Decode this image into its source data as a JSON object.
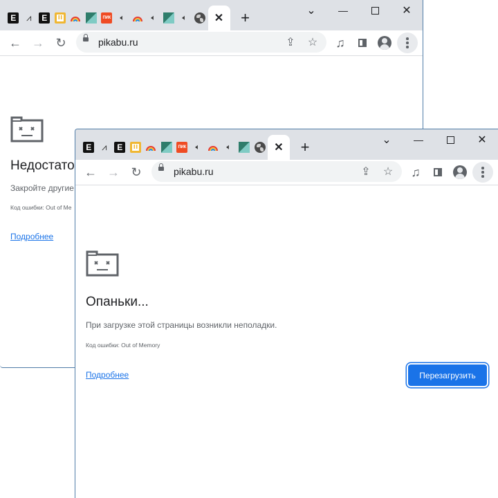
{
  "browser": {
    "url": "pikabu.ru",
    "new_tab_glyph": "+",
    "tab_close_glyph": "✕"
  },
  "favicons": [
    "e-logo-icon",
    "wave-icon",
    "e-logo-icon",
    "pause-logo-icon",
    "rainbow-icon",
    "mosaic-icon",
    "pik-logo-icon",
    "volume-icon",
    "rainbow-icon",
    "volume-icon",
    "mosaic-icon",
    "volume-icon",
    "globe-icon"
  ],
  "favicon_letters": {
    "e": "E",
    "pik": "ПИК"
  },
  "window_controls": {
    "chevron": "⌄",
    "minimize": "—",
    "close": "✕"
  },
  "toolbar_glyphs": {
    "back": "←",
    "forward": "→",
    "reload": "↻",
    "share": "⇪",
    "star": "☆",
    "media": "♫"
  },
  "back_window": {
    "title": "Недостато",
    "description": "Закройте другие в",
    "error_code": "Код ошибки: Out of Me",
    "details_link": "Подробнее"
  },
  "front_window": {
    "title": "Опаньки...",
    "description": "При загрузке этой страницы возникли неполадки.",
    "error_code": "Код ошибки: Out of Memory",
    "details_link": "Подробнее",
    "reload_button": "Перезагрузить"
  },
  "colors": {
    "tabstrip": "#dee1e6",
    "accent": "#1a73e8",
    "window_border": "#4e7ba6"
  }
}
